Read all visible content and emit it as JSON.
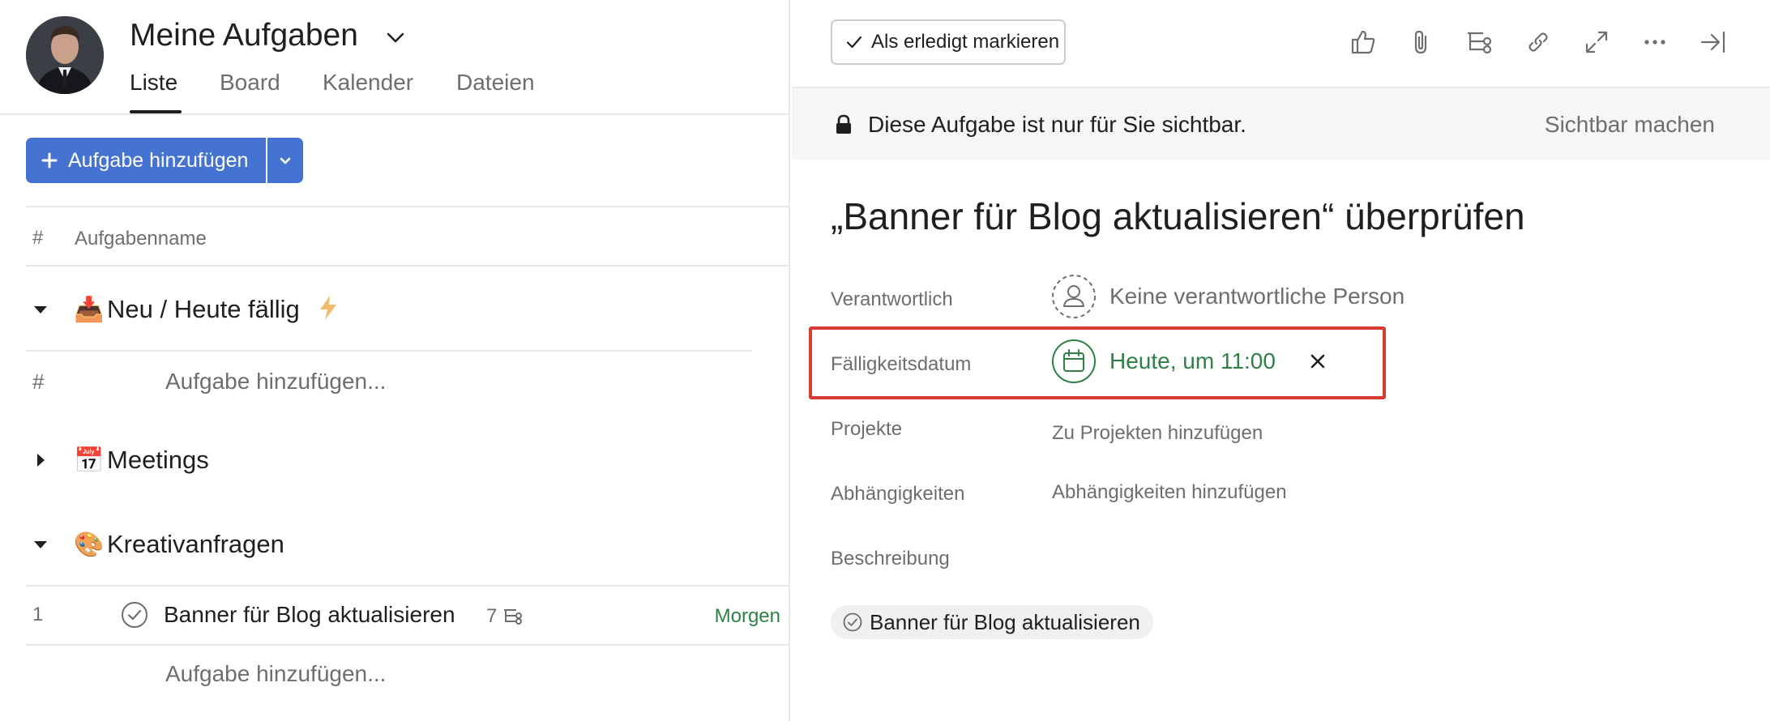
{
  "left": {
    "page_title": "Meine Aufgaben",
    "tabs": [
      "Liste",
      "Board",
      "Kalender",
      "Dateien"
    ],
    "add_task_button": "Aufgabe hinzufügen",
    "column_headers": {
      "number": "#",
      "name": "Aufgabenname"
    },
    "sections": [
      {
        "emoji": "📥",
        "name": "Neu / Heute fällig",
        "expanded": true,
        "has_bolt": true
      },
      {
        "emoji": "📅",
        "name": "Meetings",
        "expanded": false
      },
      {
        "emoji": "🎨",
        "name": "Kreativanfragen",
        "expanded": true
      }
    ],
    "add_task_row": {
      "hash": "#",
      "label": "Aufgabe hinzufügen..."
    },
    "task": {
      "number": "1",
      "name": "Banner für Blog aktualisieren",
      "subtask_count": "7",
      "due": "Morgen"
    },
    "add_task_row_bottom": "Aufgabe hinzufügen..."
  },
  "right": {
    "mark_done_button": "Als erledigt markieren",
    "toolbar_icons": [
      "like-icon",
      "attachment-icon",
      "subtask-icon",
      "link-icon",
      "fullscreen-icon",
      "more-icon",
      "close-pane-icon"
    ],
    "privacy_banner": {
      "text": "Diese Aufgabe ist nur für Sie sichtbar.",
      "action": "Sichtbar machen"
    },
    "task_title": "„Banner für Blog aktualisieren“ überprüfen",
    "fields": {
      "assignee_label": "Verantwortlich",
      "assignee_value": "Keine verantwortliche Person",
      "due_label": "Fälligkeitsdatum",
      "due_value": "Heute, um 11:00",
      "projects_label": "Projekte",
      "projects_action": "Zu Projekten hinzufügen",
      "dependencies_label": "Abhängigkeiten",
      "dependencies_action": "Abhängigkeiten hinzufügen",
      "description_label": "Beschreibung"
    },
    "parent_task": "Banner für Blog aktualisieren"
  },
  "colors": {
    "primary_blue": "#4573d2",
    "due_green": "#2e8047",
    "highlight_red": "#db3b35",
    "muted_text": "#6d6e6f"
  }
}
